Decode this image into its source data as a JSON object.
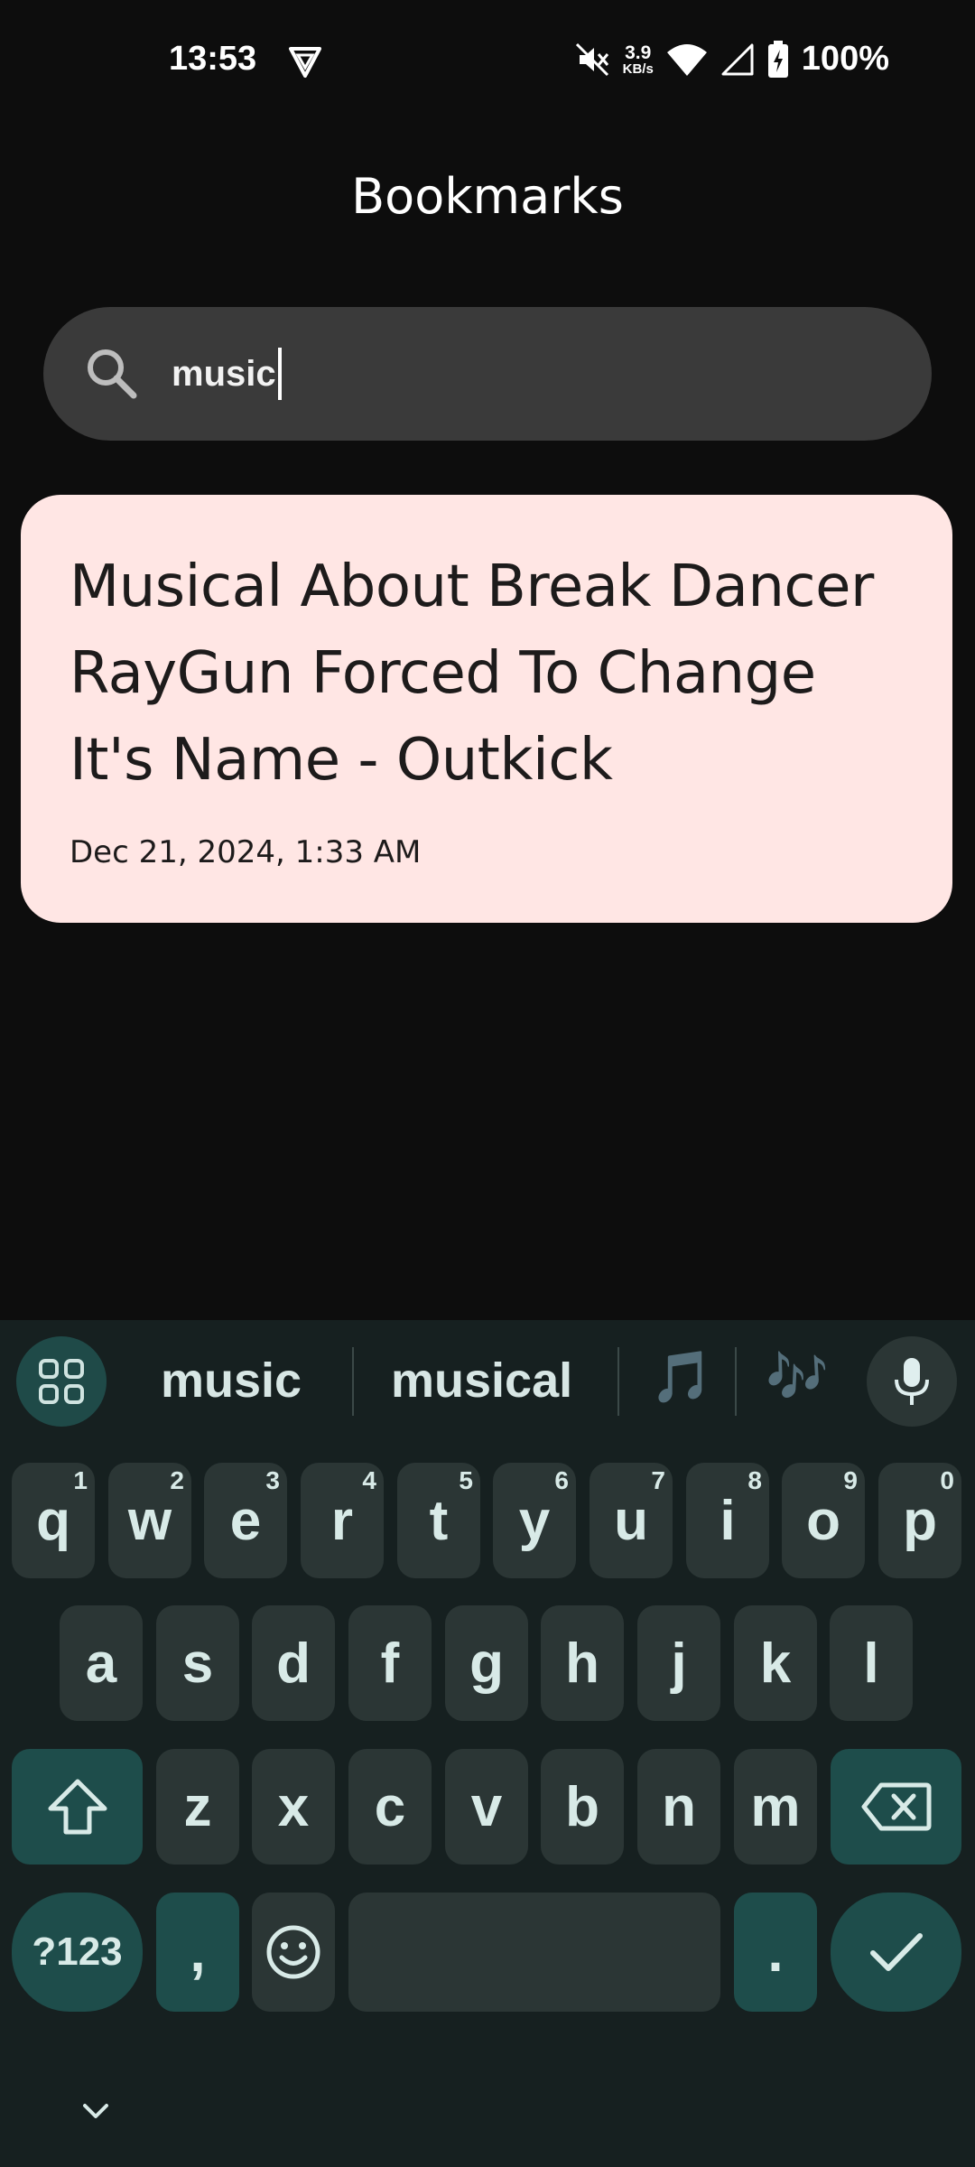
{
  "status_bar": {
    "time": "13:53",
    "net_speed_value": "3.9",
    "net_speed_unit": "KB/s",
    "battery": "100%",
    "icons": [
      "vpn-icon",
      "mute-icon",
      "wifi-icon",
      "signal-icon",
      "battery-icon"
    ]
  },
  "page": {
    "title": "Bookmarks"
  },
  "search": {
    "value": "music",
    "icon": "search-icon"
  },
  "results": [
    {
      "title": "Musical About Break Dancer RayGun Forced To Change It's Name - Outkick",
      "date": "Dec 21, 2024, 1:33 AM"
    }
  ],
  "keyboard": {
    "suggestions": [
      "music",
      "musical",
      "🎵",
      "🎶"
    ],
    "row1": [
      {
        "key": "q",
        "hint": "1"
      },
      {
        "key": "w",
        "hint": "2"
      },
      {
        "key": "e",
        "hint": "3"
      },
      {
        "key": "r",
        "hint": "4"
      },
      {
        "key": "t",
        "hint": "5"
      },
      {
        "key": "y",
        "hint": "6"
      },
      {
        "key": "u",
        "hint": "7"
      },
      {
        "key": "i",
        "hint": "8"
      },
      {
        "key": "o",
        "hint": "9"
      },
      {
        "key": "p",
        "hint": "0"
      }
    ],
    "row2": [
      "a",
      "s",
      "d",
      "f",
      "g",
      "h",
      "j",
      "k",
      "l"
    ],
    "row3": [
      "z",
      "x",
      "c",
      "v",
      "b",
      "n",
      "m"
    ],
    "symbols_label": "?123",
    "comma": ",",
    "period": "."
  },
  "colors": {
    "background": "#0d0d0d",
    "search_bg": "#3a3a3a",
    "card_bg": "#ffe6e4",
    "keyboard_bg": "#162020",
    "key_bg": "#2b3635",
    "key_accent": "#1e4d4b"
  }
}
